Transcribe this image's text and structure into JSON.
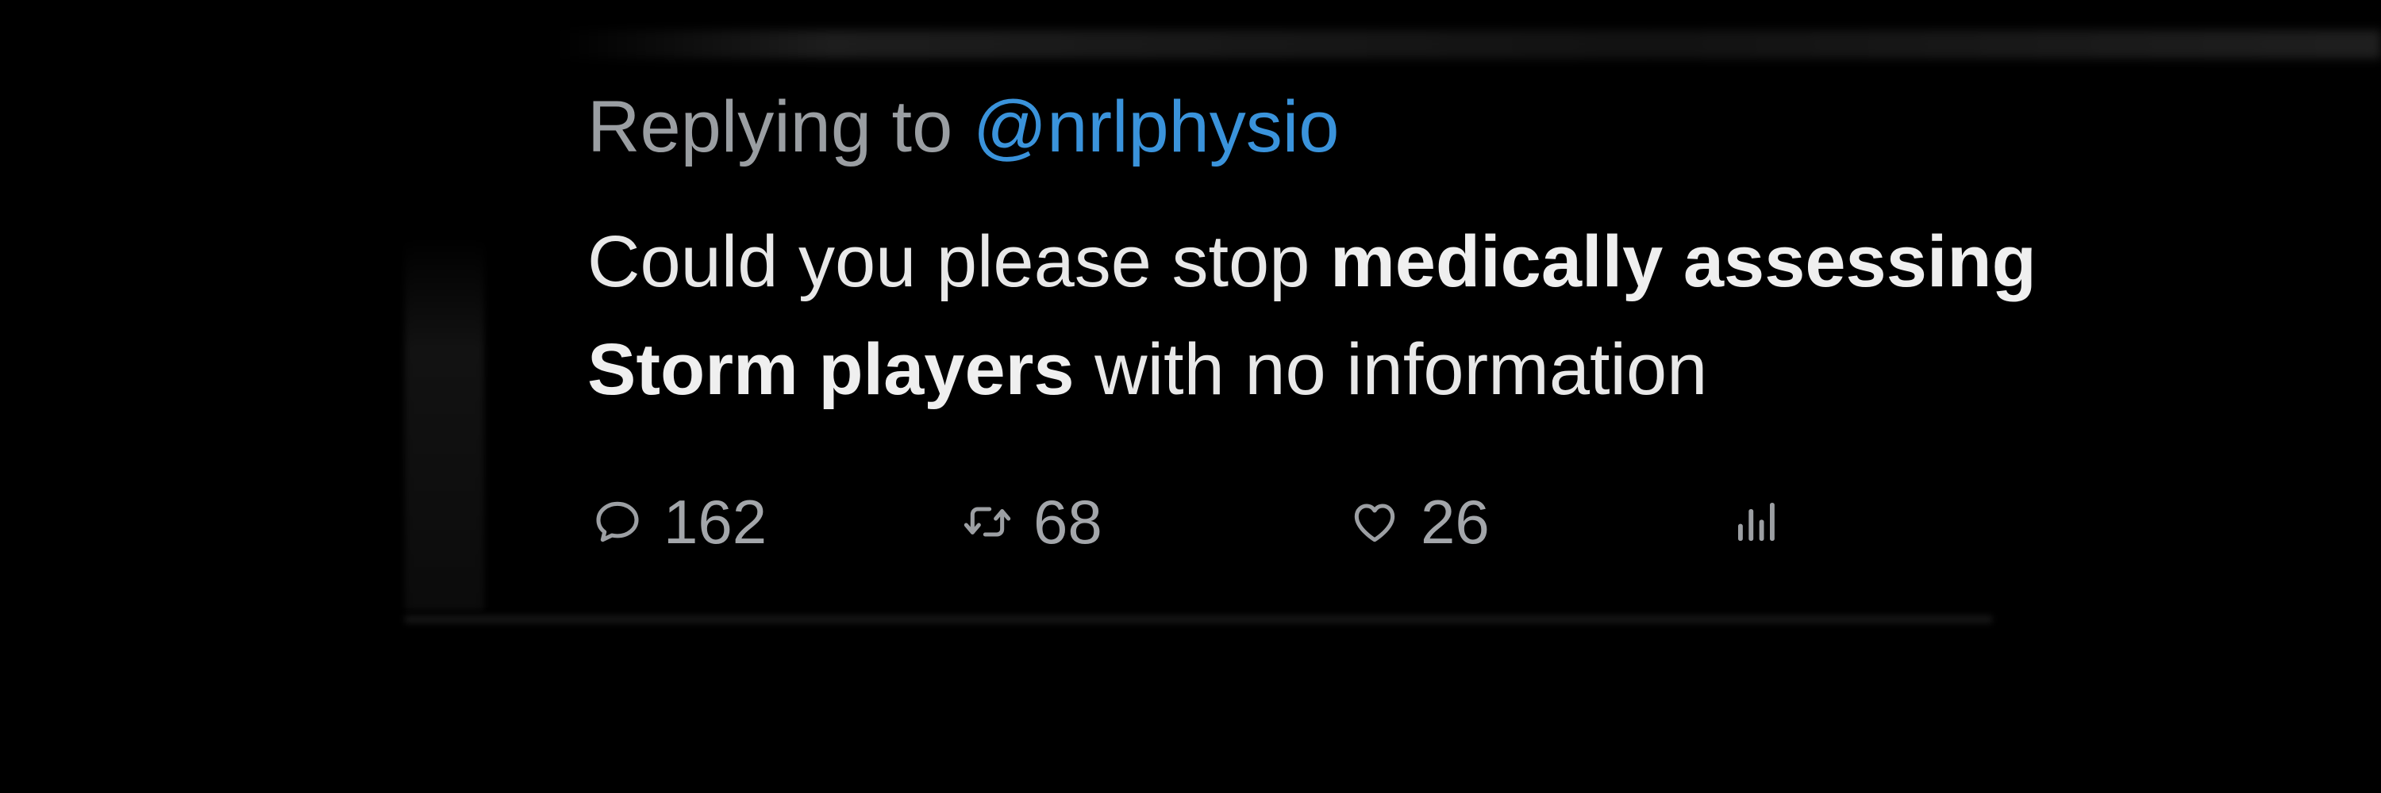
{
  "tweet": {
    "reply_prefix": "Replying to ",
    "reply_handle": "@nrlphysio",
    "body": {
      "part1": "Could you please stop ",
      "bold1": "medically assessing",
      "bold2": "Storm players",
      "part2": " with no information"
    }
  },
  "actions": {
    "reply": {
      "icon": "reply-bubble-icon",
      "count": "162"
    },
    "retweet": {
      "icon": "retweet-icon",
      "count": "68"
    },
    "like": {
      "icon": "heart-icon",
      "count": "26"
    },
    "views": {
      "icon": "views-chart-icon"
    }
  },
  "colors": {
    "background": "#000000",
    "text": "#e8e8e8",
    "muted": "#9a9ea2",
    "mention": "#3a93db"
  }
}
